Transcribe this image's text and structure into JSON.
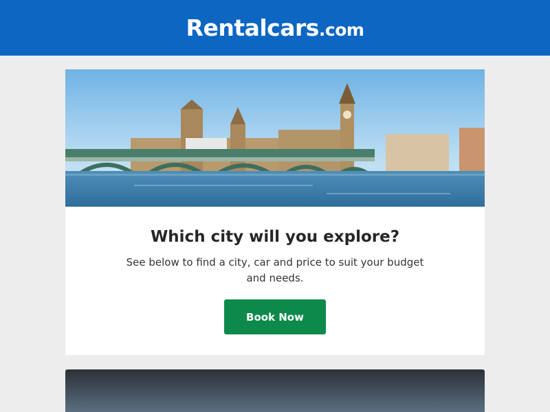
{
  "header": {
    "logo_main": "Rentalcars",
    "logo_tld": ".com"
  },
  "hero": {
    "headline": "Which city will you explore?",
    "subcopy": "See below to find a city, car and price to suit your budget and needs.",
    "cta_label": "Book Now"
  },
  "colors": {
    "brand_blue": "#0c66c2",
    "cta_green": "#0d8a4b",
    "page_bg": "#ededed"
  }
}
